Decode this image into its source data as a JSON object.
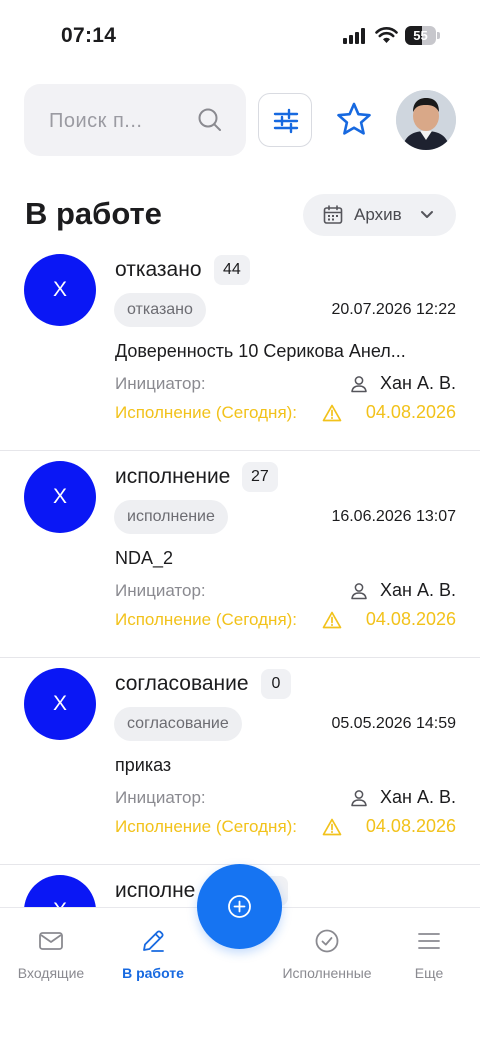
{
  "status_bar": {
    "time": "07:14",
    "battery": "55",
    "battery_level_percent": 55
  },
  "header": {
    "search_placeholder": "Поиск п...",
    "icons": {
      "search": "search-icon",
      "filter": "filter-sliders-icon",
      "favorites": "star-icon",
      "avatar": "user-avatar"
    }
  },
  "page": {
    "title": "В работе",
    "archive_label": "Архив"
  },
  "colors": {
    "accent": "#1674f2",
    "avatar_bg": "#0a17f5",
    "due": "#f2c21b",
    "active_nav": "#1769e0"
  },
  "cards": [
    {
      "avatar_letter": "Х",
      "title": "отказано",
      "count": "44",
      "status": "отказано",
      "date": "20.07.2026 12:22",
      "document": "Доверенность 10 Серикова Анел...",
      "initiator_label": "Инициатор:",
      "initiator": "Хан А. В.",
      "due_label": "Исполнение (Сегодня):",
      "due_date": "04.08.2026"
    },
    {
      "avatar_letter": "Х",
      "title": "исполнение",
      "count": "27",
      "status": "исполнение",
      "date": "16.06.2026 13:07",
      "document": "NDA_2",
      "initiator_label": "Инициатор:",
      "initiator": "Хан А. В.",
      "due_label": "Исполнение (Сегодня):",
      "due_date": "04.08.2026"
    },
    {
      "avatar_letter": "Х",
      "title": "согласование",
      "count": "0",
      "status": "согласование",
      "date": "05.05.2026 14:59",
      "document": "приказ",
      "initiator_label": "Инициатор:",
      "initiator": "Хан А. В.",
      "due_label": "Исполнение (Сегодня):",
      "due_date": "04.08.2026"
    },
    {
      "avatar_letter": "Х",
      "title": "исполне",
      "count": "6",
      "status": "",
      "date": "",
      "document": "",
      "initiator_label": "",
      "initiator": "",
      "due_label": "",
      "due_date": ""
    }
  ],
  "nav": [
    {
      "label": "Входящие",
      "icon": "mail-icon",
      "active": false
    },
    {
      "label": "В работе",
      "icon": "pencil-icon",
      "active": true
    },
    {
      "label": "Исполненные",
      "icon": "check-circle-icon",
      "active": false
    },
    {
      "label": "Еще",
      "icon": "menu-icon",
      "active": false
    }
  ],
  "fab_icon": "plus-circle-icon"
}
